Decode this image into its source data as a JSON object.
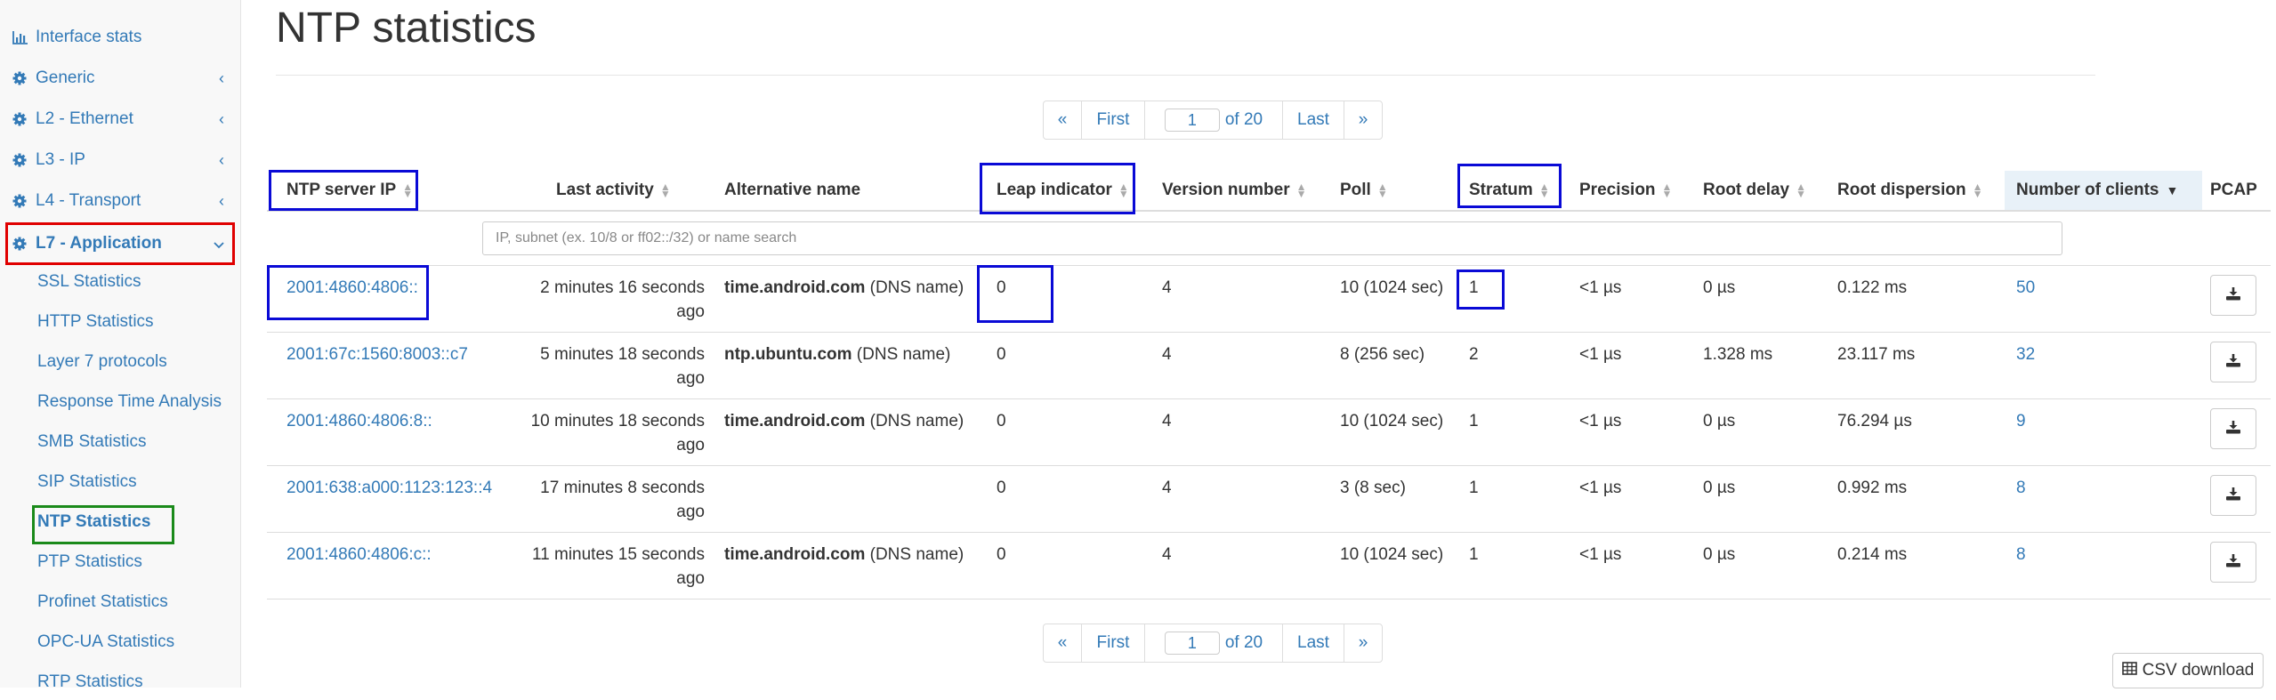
{
  "sidebar": {
    "interface_stats": "Interface stats",
    "generic": "Generic",
    "l2": "L2 - Ethernet",
    "l3": "L3 - IP",
    "l4": "L4 - Transport",
    "l7": "L7 - Application",
    "sub": {
      "ssl": "SSL Statistics",
      "http": "HTTP Statistics",
      "layer7": "Layer 7 protocols",
      "rta": "Response Time Analysis",
      "smb": "SMB Statistics",
      "sip": "SIP Statistics",
      "ntp": "NTP Statistics",
      "ptp": "PTP Statistics",
      "profinet": "Profinet Statistics",
      "opcua": "OPC-UA Statistics",
      "rtp": "RTP Statistics"
    }
  },
  "page": {
    "title": "NTP statistics"
  },
  "pager": {
    "prev": "«",
    "first": "First",
    "page": "1",
    "of": "of 20",
    "last": "Last",
    "next": "»"
  },
  "columns": {
    "ip": "NTP server IP",
    "last_activity": "Last activity",
    "alt_name": "Alternative name",
    "leap": "Leap indicator",
    "version": "Version number",
    "poll": "Poll",
    "stratum": "Stratum",
    "precision": "Precision",
    "root_delay": "Root delay",
    "root_dispersion": "Root dispersion",
    "clients": "Number of clients",
    "pcap": "PCAP"
  },
  "filter": {
    "placeholder": "IP, subnet (ex. 10/8 or ff02::/32) or name search"
  },
  "rows": [
    {
      "ip": "2001:4860:4806::",
      "last1": "2 minutes 16 seconds",
      "last2": "ago",
      "alt_name": "time.android.com",
      "alt_suffix": " (DNS name)",
      "leap": "0",
      "version": "4",
      "poll": "10 (1024 sec)",
      "stratum": "1",
      "precision": "<1 µs",
      "root_delay": "0 µs",
      "root_dispersion": "0.122 ms",
      "clients": "50"
    },
    {
      "ip": "2001:67c:1560:8003::c7",
      "last1": "5 minutes 18 seconds",
      "last2": "ago",
      "alt_name": "ntp.ubuntu.com",
      "alt_suffix": " (DNS name)",
      "leap": "0",
      "version": "4",
      "poll": "8 (256 sec)",
      "stratum": "2",
      "precision": "<1 µs",
      "root_delay": "1.328 ms",
      "root_dispersion": "23.117 ms",
      "clients": "32"
    },
    {
      "ip": "2001:4860:4806:8::",
      "last1": "10 minutes 18 seconds",
      "last2": "ago",
      "alt_name": "time.android.com",
      "alt_suffix": " (DNS name)",
      "leap": "0",
      "version": "4",
      "poll": "10 (1024 sec)",
      "stratum": "1",
      "precision": "<1 µs",
      "root_delay": "0 µs",
      "root_dispersion": "76.294 µs",
      "clients": "9"
    },
    {
      "ip": "2001:638:a000:1123:123::4",
      "last1": "17 minutes 8 seconds",
      "last2": "ago",
      "alt_name": "",
      "alt_suffix": "",
      "leap": "0",
      "version": "4",
      "poll": "3 (8 sec)",
      "stratum": "1",
      "precision": "<1 µs",
      "root_delay": "0 µs",
      "root_dispersion": "0.992 ms",
      "clients": "8"
    },
    {
      "ip": "2001:4860:4806:c::",
      "last1": "11 minutes 15 seconds",
      "last2": "ago",
      "alt_name": "time.android.com",
      "alt_suffix": " (DNS name)",
      "leap": "0",
      "version": "4",
      "poll": "10 (1024 sec)",
      "stratum": "1",
      "precision": "<1 µs",
      "root_delay": "0 µs",
      "root_dispersion": "0.214 ms",
      "clients": "8"
    }
  ],
  "csv": {
    "label": "CSV download"
  },
  "colors": {
    "link": "#337ab7",
    "highlight_blue": "#0a0ad6",
    "highlight_red": "#e00000",
    "highlight_green": "#1a8a1a",
    "sorted_header_bg": "#e8f1f8"
  }
}
